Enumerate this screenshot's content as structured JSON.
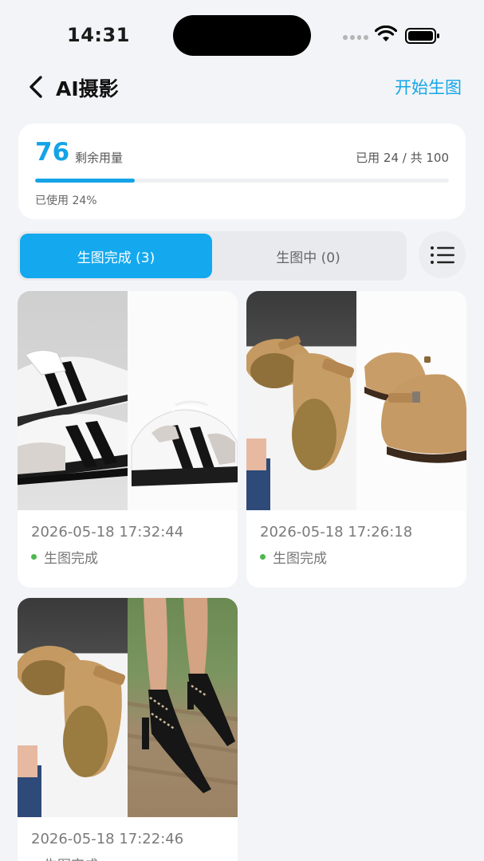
{
  "status_bar": {
    "time": "14:31"
  },
  "header": {
    "title": "AI摄影",
    "action_label": "开始生图"
  },
  "quota": {
    "remaining": "76",
    "remaining_label": "剩余用量",
    "usage_text": "已用 24 / 共 100",
    "used_fraction": 0.24,
    "used_text": "已使用 24%",
    "accent_color": "#14a3e6"
  },
  "tabs": [
    {
      "label": "生图完成 (3)",
      "active": true
    },
    {
      "label": "生图中 (0)",
      "active": false
    }
  ],
  "list_button_icon": "list-icon",
  "items": [
    {
      "date": "2026-05-18 17:32:44",
      "status": "生图完成",
      "image": "white-black-sneakers"
    },
    {
      "date": "2026-05-18 17:26:18",
      "status": "生图完成",
      "image": "tan-suede-clogs"
    },
    {
      "date": "2026-05-18 17:22:46",
      "status": "生图完成",
      "image": "clogs-and-studded-heels"
    }
  ],
  "colors": {
    "status_green": "#4cb84c",
    "tab_active": "#14a9ef"
  }
}
